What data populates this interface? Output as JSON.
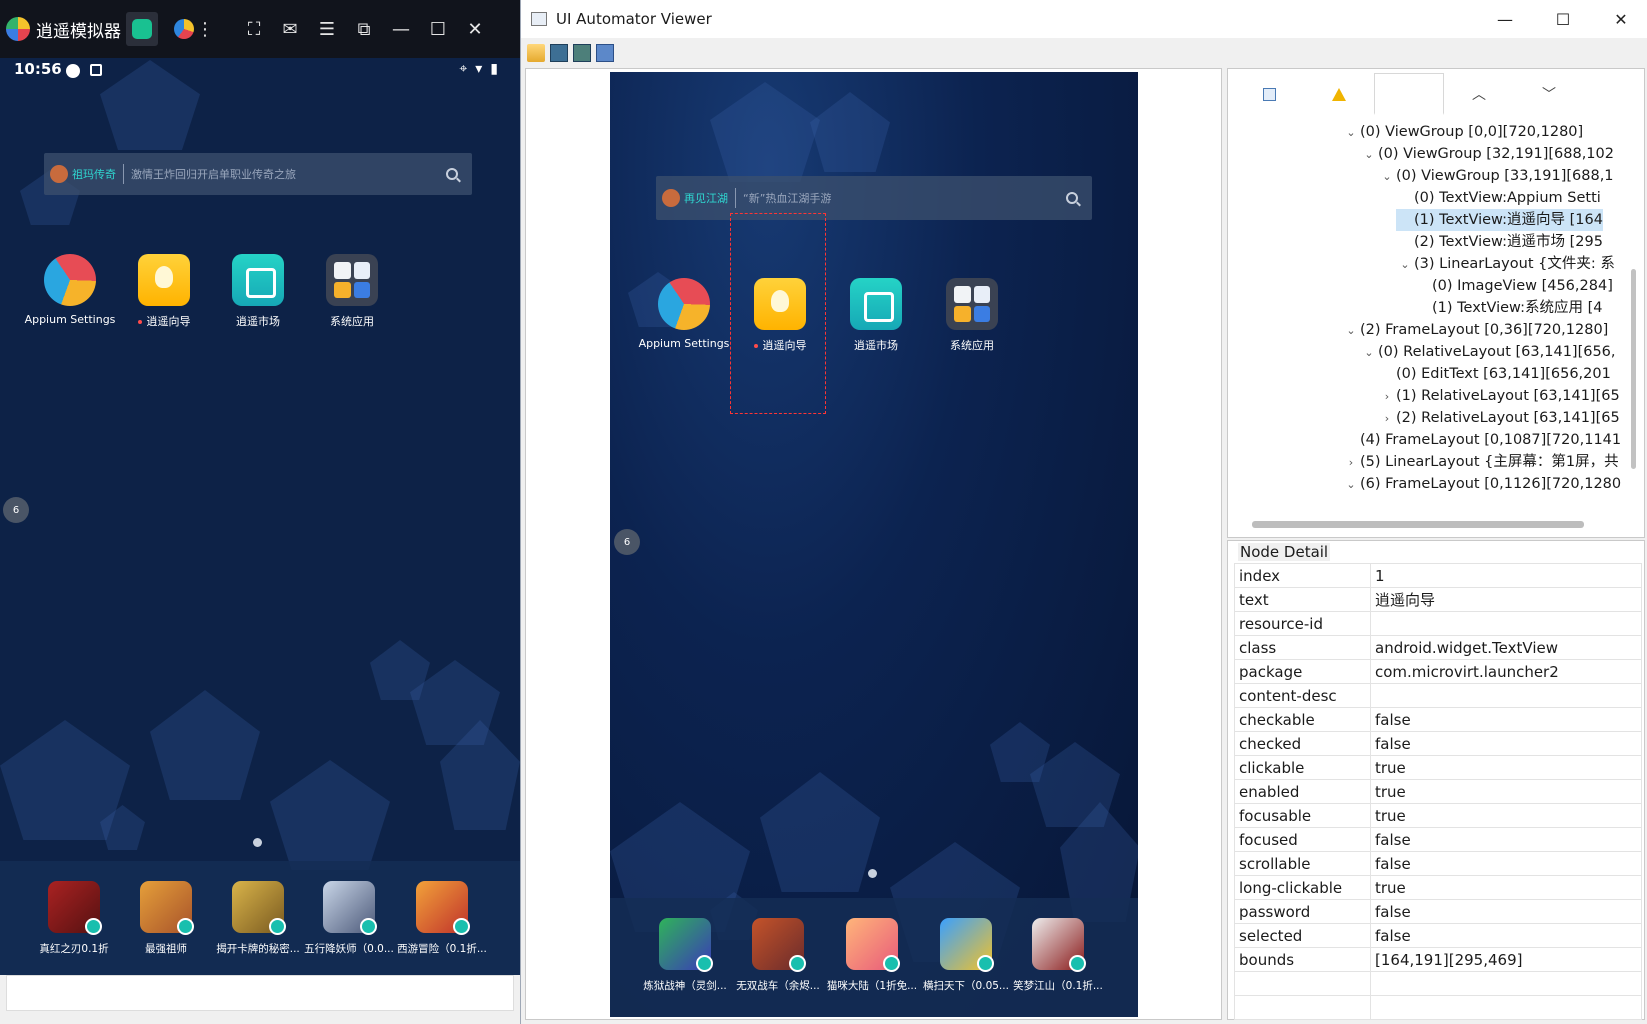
{
  "emulator": {
    "title": "逍遥模拟器",
    "status_time": "10:56",
    "search": {
      "game": "祖玛传奇",
      "hint": "激情王炸回归开启单职业传奇之旅"
    },
    "apps": [
      {
        "label": "Appium Settings",
        "icon": "appium-settings-icon"
      },
      {
        "label": "逍遥向导",
        "icon": "lightbulb-guide-icon",
        "new_dot": true
      },
      {
        "label": "逍遥市场",
        "icon": "market-bag-icon"
      },
      {
        "label": "系统应用",
        "icon": "system-apps-folder-icon"
      }
    ],
    "float_ball": "6",
    "dock": [
      "真红之刃0.1折",
      "最强祖师",
      "揭开卡牌的秘密...",
      "五行降妖师（0.0...",
      "西游冒险（0.1折..."
    ]
  },
  "viewer": {
    "title": "UI Automator Viewer",
    "screenshot": {
      "search": {
        "game": "再见江湖",
        "hint": "“新”热血江湖手游"
      },
      "apps": [
        {
          "label": "Appium Settings"
        },
        {
          "label": "逍遥向导",
          "new_dot": true
        },
        {
          "label": "逍遥市场"
        },
        {
          "label": "系统应用"
        }
      ],
      "float_ball": "6",
      "dock": [
        "炼狱战神（灵剑...",
        "无双战车（余烬...",
        "猫咪大陆（1折免...",
        "横扫天下（0.05...",
        "笑梦江山（0.1折..."
      ]
    },
    "tree": [
      {
        "depth": 0,
        "chev": "v",
        "text": "(0) ViewGroup [0,0][720,1280]"
      },
      {
        "depth": 1,
        "chev": "v",
        "text": "(0) ViewGroup [32,191][688,102"
      },
      {
        "depth": 2,
        "chev": "v",
        "text": "(0) ViewGroup [33,191][688,1"
      },
      {
        "depth": 3,
        "chev": "",
        "text": "(0) TextView:Appium Setti"
      },
      {
        "depth": 3,
        "chev": "",
        "text": "(1) TextView:逍遥向导 [164",
        "selected": true
      },
      {
        "depth": 3,
        "chev": "",
        "text": "(2) TextView:逍遥市场 [295"
      },
      {
        "depth": 3,
        "chev": "v",
        "text": "(3) LinearLayout {文件夹: 系"
      },
      {
        "depth": 4,
        "chev": "",
        "text": "(0) ImageView [456,284]"
      },
      {
        "depth": 4,
        "chev": "",
        "text": "(1) TextView:系统应用 [4"
      },
      {
        "depth": 0,
        "chev": "v",
        "text": "(2) FrameLayout [0,36][720,1280]"
      },
      {
        "depth": 1,
        "chev": "v",
        "text": "(0) RelativeLayout [63,141][656,"
      },
      {
        "depth": 2,
        "chev": "",
        "text": "(0) EditText [63,141][656,201"
      },
      {
        "depth": 2,
        "chev": ">",
        "text": "(1) RelativeLayout [63,141][65"
      },
      {
        "depth": 2,
        "chev": ">",
        "text": "(2) RelativeLayout [63,141][65"
      },
      {
        "depth": 0,
        "chev": "",
        "text": "(4) FrameLayout [0,1087][720,1141"
      },
      {
        "depth": 0,
        "chev": ">",
        "text": "(5) LinearLayout {主屏幕：第1屏，共"
      },
      {
        "depth": 0,
        "chev": "v",
        "text": "(6) FrameLayout [0,1126][720,1280"
      }
    ],
    "detail_title": "Node Detail",
    "details": [
      [
        "index",
        "1"
      ],
      [
        "text",
        "逍遥向导"
      ],
      [
        "resource-id",
        ""
      ],
      [
        "class",
        "android.widget.TextView"
      ],
      [
        "package",
        "com.microvirt.launcher2"
      ],
      [
        "content-desc",
        ""
      ],
      [
        "checkable",
        "false"
      ],
      [
        "checked",
        "false"
      ],
      [
        "clickable",
        "true"
      ],
      [
        "enabled",
        "true"
      ],
      [
        "focusable",
        "true"
      ],
      [
        "focused",
        "false"
      ],
      [
        "scrollable",
        "false"
      ],
      [
        "long-clickable",
        "true"
      ],
      [
        "password",
        "false"
      ],
      [
        "selected",
        "false"
      ],
      [
        "bounds",
        "[164,191][295,469]"
      ]
    ]
  }
}
